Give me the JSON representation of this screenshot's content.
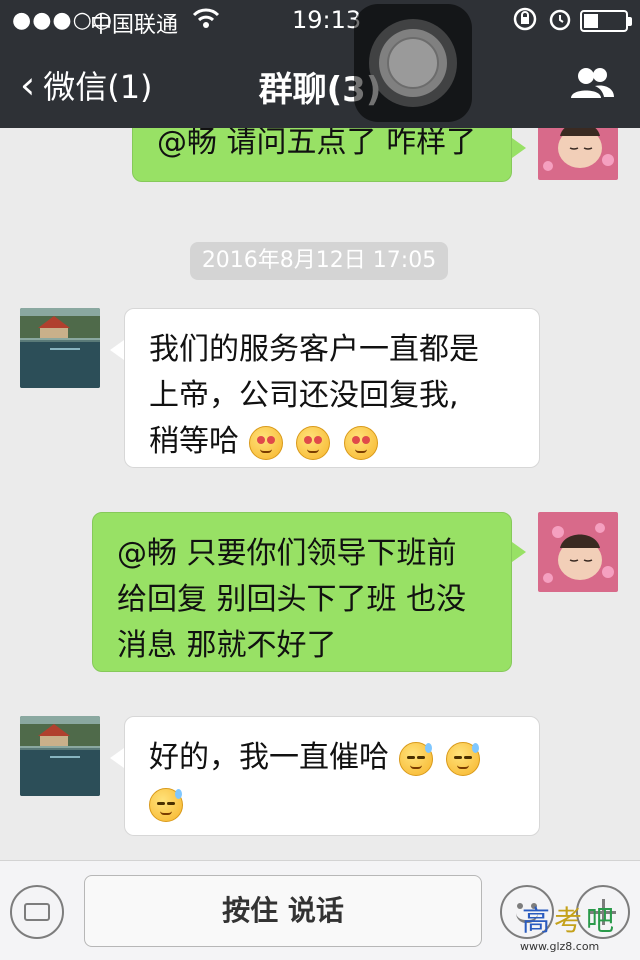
{
  "status_bar": {
    "signal": "●●●○○",
    "carrier": "中国联通",
    "time": "19:13"
  },
  "nav": {
    "back_label": "微信(1)",
    "title": "群聊(3)"
  },
  "messages": [
    {
      "side": "right",
      "text": "@畅 请问五点了 咋样了"
    },
    {
      "timestamp": "2016年8月12日 17:05"
    },
    {
      "side": "left",
      "lines": [
        "我们的服务客户一直都是",
        "上帝，公司还没回复我,",
        "稍等哈"
      ],
      "emoji": "blush-emoji"
    },
    {
      "side": "right",
      "lines": [
        "@畅 只要你们领导下班前",
        "给回复 别回头下了班 也没",
        "消息 那就不好了"
      ]
    },
    {
      "side": "left",
      "lines": [
        "好的，我一直催哈"
      ],
      "emoji": "sweat-emoji"
    }
  ],
  "input_bar": {
    "hold_to_talk": "按住 说话"
  },
  "watermark": {
    "site": "www.glz8.com"
  },
  "colors": {
    "header_bg": "#2e3136",
    "chat_bg": "#ebebeb",
    "self_bubble": "#98e165",
    "other_bubble": "#ffffff"
  }
}
